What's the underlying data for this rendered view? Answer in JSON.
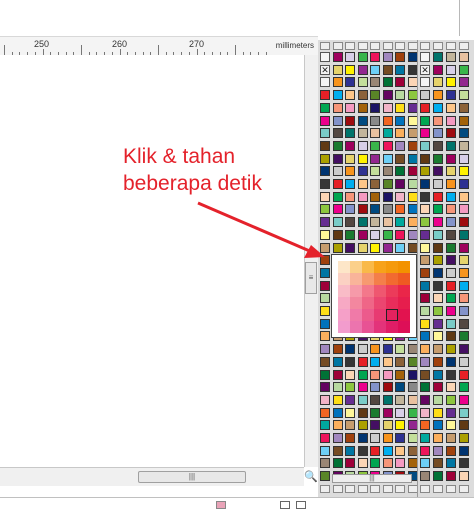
{
  "ruler": {
    "labels": [
      "250",
      "260",
      "270"
    ],
    "units": "millimeters"
  },
  "annotation": {
    "line1": "Klik & tahan",
    "line2": "beberapa detik",
    "color": "#e4222b"
  },
  "scroll": {
    "v_grip": "≡",
    "h_grip": "|||"
  },
  "zoom": {
    "icon": "zoom-icon",
    "glyph": "🔍"
  },
  "palette": {
    "colors": [
      "#e62026",
      "#f26522",
      "#f7941d",
      "#ffde17",
      "#fff200",
      "#8dc63f",
      "#39b54a",
      "#00a651",
      "#00a99d",
      "#00aeef",
      "#0072bc",
      "#2e3192",
      "#662d91",
      "#92278f",
      "#ec008c",
      "#ed145b",
      "#f69679",
      "#fbaf5d",
      "#fdc689",
      "#fff799",
      "#c4df9b",
      "#7accc8",
      "#6dcff6",
      "#8393ca",
      "#a187be",
      "#f49ac1",
      "#c69c6d",
      "#8c6239",
      "#603913",
      "#998675",
      "#534741",
      "#754c24",
      "#9e0b0f",
      "#a0410d",
      "#a36209",
      "#aba000",
      "#598527",
      "#1a7b30",
      "#007236",
      "#00746b",
      "#0076a3",
      "#004a80",
      "#003471",
      "#1b1464",
      "#440e62",
      "#630460",
      "#9e005d",
      "#9e0039",
      "#c2b59b",
      "#363636",
      "#898989",
      "#cccccc",
      "#f2b4c8",
      "#e6d36c",
      "#b8d9a0",
      "#d8d0e8",
      "#fbd5b5",
      "#e8c1a0"
    ],
    "popup_colors": [
      "#fde6c8",
      "#fbd08a",
      "#f9b949",
      "#f7a21a",
      "#f59a0c",
      "#f39200",
      "#fbd1c3",
      "#f9b49a",
      "#f79a70",
      "#f47f4a",
      "#f26a30",
      "#ef5a22",
      "#f9bcc7",
      "#f69aa9",
      "#f3788b",
      "#ef5770",
      "#ec3b5a",
      "#ea2649",
      "#f7a9c4",
      "#f3879f",
      "#ef6687",
      "#eb4670",
      "#e82d5b",
      "#e61e4d",
      "#f5a0c8",
      "#f07aa8",
      "#ec5a8c",
      "#e83a72",
      "#e4225e",
      "#e2134f",
      "#f29ccd",
      "#ec74ae",
      "#e85294",
      "#e3337a",
      "#e01d66",
      "#dd0f57"
    ],
    "popup_selected_index": 28
  }
}
